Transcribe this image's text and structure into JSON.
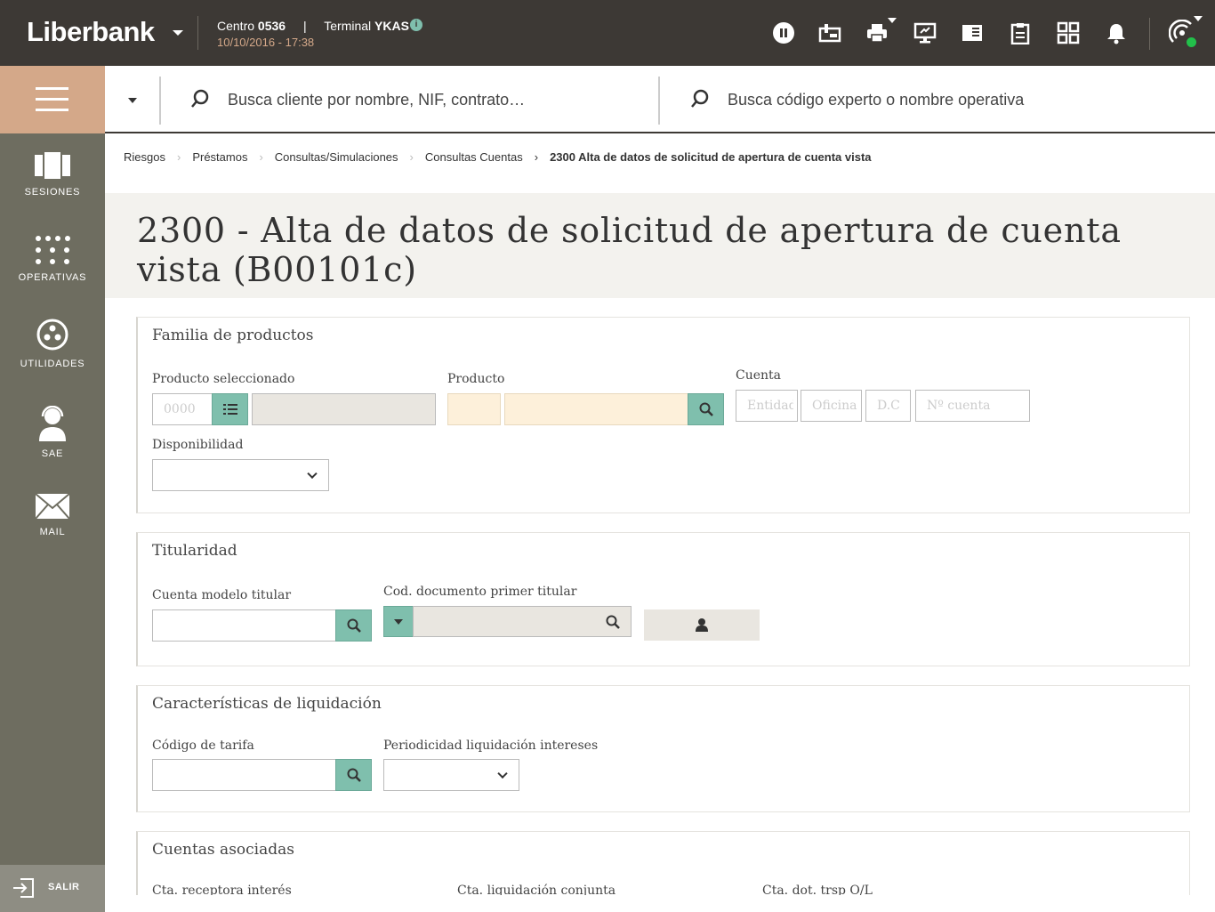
{
  "topbar": {
    "brand": "Liberbank",
    "centro_label": "Centro",
    "centro_value": "0536",
    "separator": "|",
    "terminal_label": "Terminal",
    "terminal_value": "YKAS",
    "datetime": "10/10/2016 - 17:38",
    "info": "i",
    "icons": [
      "pause-icon",
      "cash-drawer-icon",
      "printer-icon",
      "monitor-icon",
      "book-icon",
      "clipboard-icon",
      "apps-grid-icon",
      "bell-icon",
      "signal-icon"
    ],
    "status_color": "#22c04a"
  },
  "sidebar": {
    "items": [
      {
        "label": "SESIONES",
        "icon": "sessions-icon"
      },
      {
        "label": "OPERATIVAS",
        "icon": "dots-grid-icon"
      },
      {
        "label": "UTILIDADES",
        "icon": "utilities-icon"
      },
      {
        "label": "SAE",
        "icon": "support-agent-icon"
      },
      {
        "label": "MAIL",
        "icon": "mail-icon"
      }
    ],
    "logout": "SALIR"
  },
  "search": {
    "client_placeholder": "Busca cliente por nombre, NIF, contrato…",
    "operation_placeholder": "Busca código experto o nombre operativa"
  },
  "breadcrumb": {
    "items": [
      "Riesgos",
      "Préstamos",
      "Consultas/Simulaciones",
      "Consultas Cuentas"
    ],
    "current": "2300 Alta de datos de solicitud de apertura de cuenta vista"
  },
  "page": {
    "title": "2300 - Alta de datos de solicitud de apertura de cuenta vista (B00101c)"
  },
  "familia": {
    "title": "Familia de productos",
    "producto_seleccionado_label": "Producto seleccionado",
    "producto_seleccionado_placeholder": "0000",
    "producto_label": "Producto",
    "cuenta_label": "Cuenta",
    "cuenta_entidad_placeholder": "Entidad",
    "cuenta_oficina_placeholder": "Oficina",
    "cuenta_dc_placeholder": "D.C",
    "cuenta_numero_placeholder": "Nº cuenta",
    "disponibilidad_label": "Disponibilidad",
    "disponibilidad_value": ""
  },
  "titularidad": {
    "title": "Titularidad",
    "cuenta_modelo_label": "Cuenta modelo titular",
    "cod_documento_label": "Cod. documento primer titular"
  },
  "liquidacion": {
    "title": "Características de liquidación",
    "codigo_tarifa_label": "Código de tarifa",
    "periodicidad_label": "Periodicidad liquidación intereses",
    "periodicidad_value": ""
  },
  "asociadas": {
    "title": "Cuentas asociadas",
    "cta_receptora_label": "Cta. receptora interés",
    "cta_liquidacion_label": "Cta. liquidación conjunta",
    "cta_dot_label": "Cta. dot. trsp O/L"
  },
  "colors": {
    "topbar": "#3d3935",
    "accent": "#d4a889",
    "sidebar": "#6e6d60",
    "teal": "#7fbfad"
  }
}
